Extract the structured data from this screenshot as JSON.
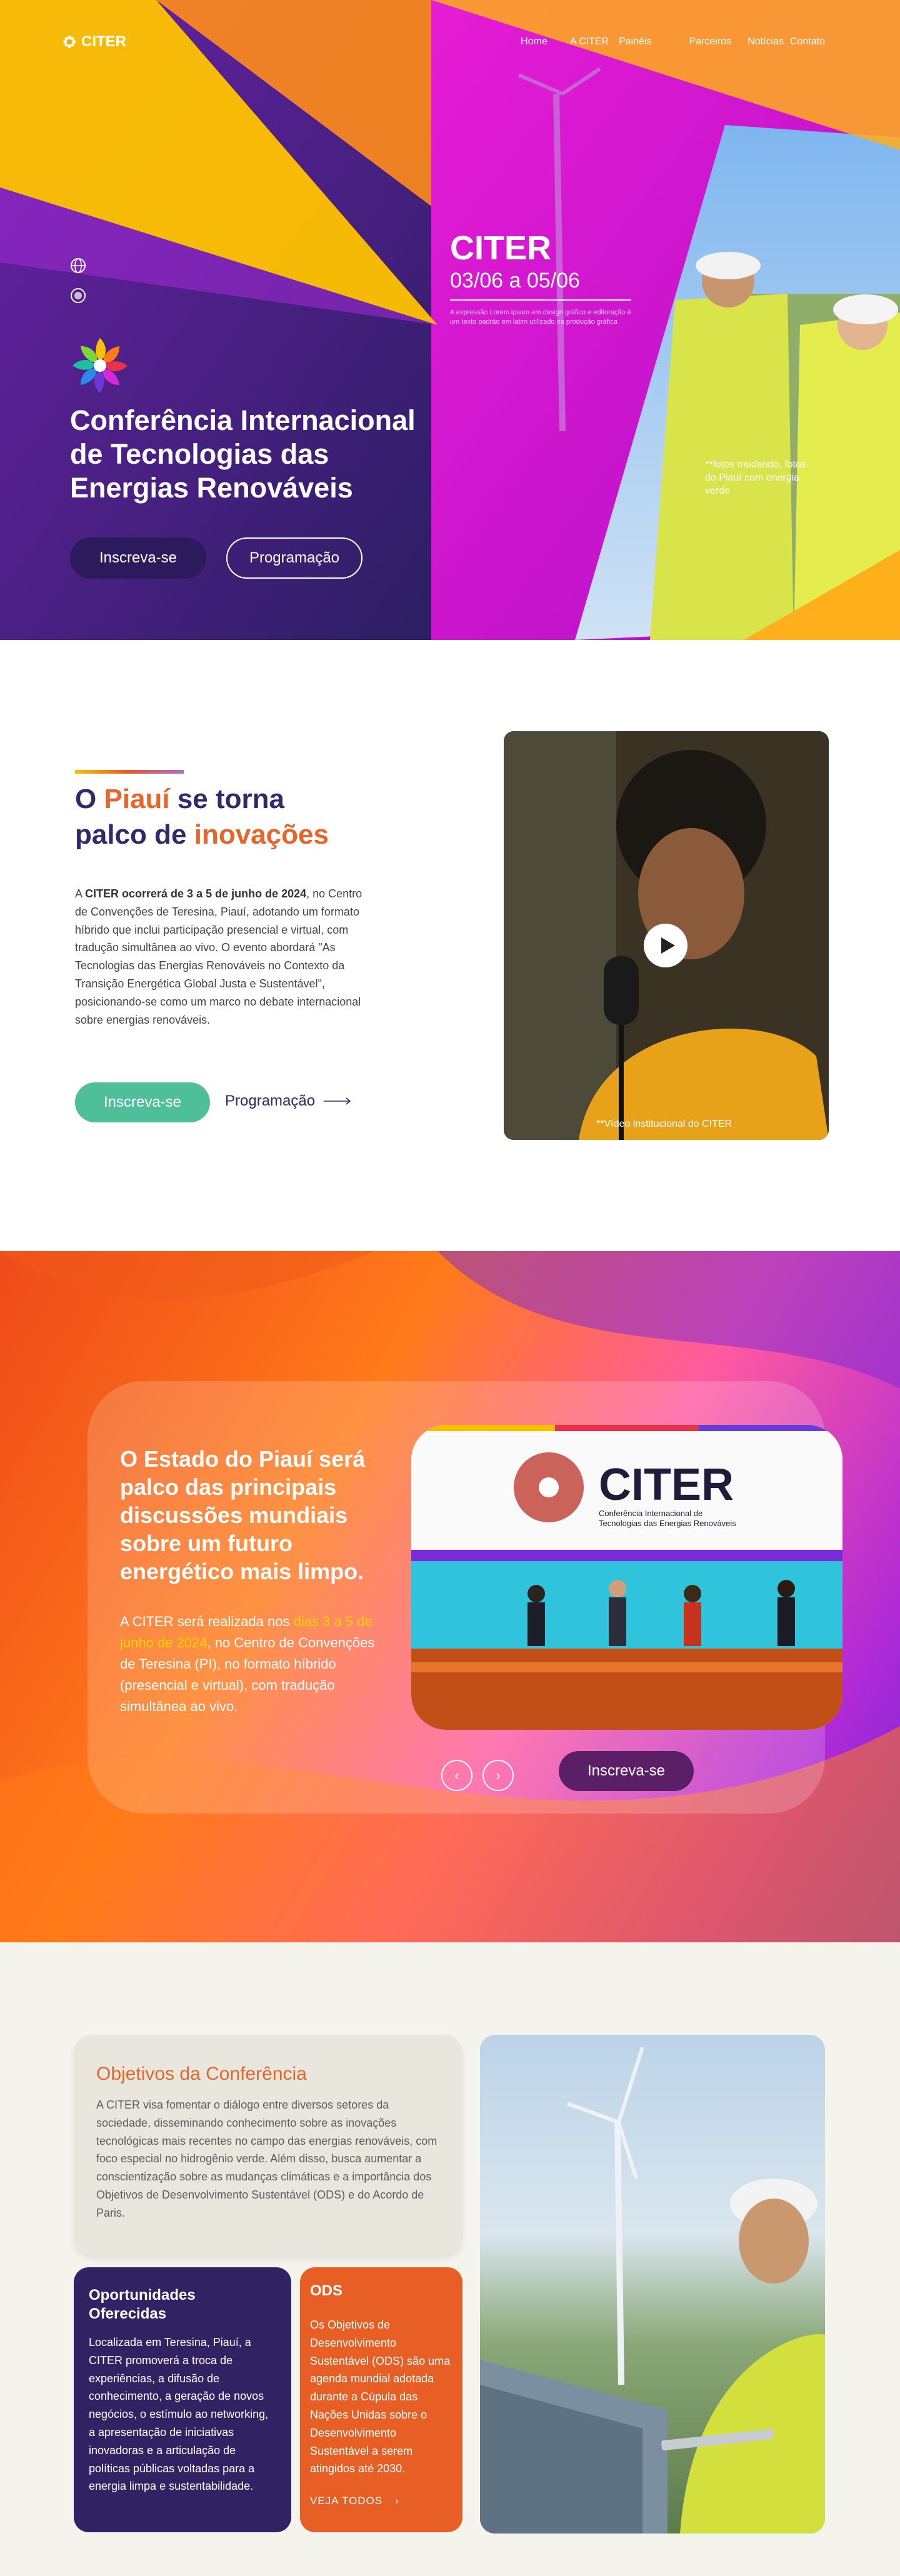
{
  "brand": {
    "name": "CITER"
  },
  "nav": {
    "links": [
      "Home",
      "A CITER",
      "Painéis",
      "Parceiros",
      "Notícias",
      "Contato"
    ]
  },
  "hero": {
    "title": "Conferência Internacional de Tecnologias das Energias Renováveis",
    "brand_title": "CITER",
    "dates": "03/06 a 05/06",
    "lorem": "A expressão Lorem ipsum em design gráfico e editoração é um texto padrão em latim utilizado na produção gráfica",
    "photo_note": "**fotos mudando, fotos do Piauí com energia verde",
    "cta_primary": "Inscreva-se",
    "cta_secondary": "Programação"
  },
  "about": {
    "heading_parts": [
      "O ",
      "Piauí",
      " se torna",
      "palco de ",
      "inovações"
    ],
    "body_bold": "CITER ocorrerá de 3 a 5 de junho de 2024",
    "body_prefix": "A ",
    "body_rest": ", no Centro de Convenções de Teresina, Piauí, adotando um formato híbrido que inclui participação presencial e virtual, com tradução simultânea ao vivo. O evento abordará \"As Tecnologias das Energias Renováveis no Contexto da Transição Energética Global Justa e Sustentável\", posicionando-se como um marco no debate internacional sobre energias renováveis.",
    "cta_primary": "Inscreva-se",
    "cta_link": "Programação",
    "video_caption": "**Vídeo institucional do CITER"
  },
  "state": {
    "title_plain_1": "O Estado do Piauí será palco das principais ",
    "title_bold": "discussões mundiais sobre um futuro energético",
    "title_plain_2": " mais limpo.",
    "text_prefix": "A CITER será realizada nos ",
    "text_highlight": "dias 3 a 5 de junho de 2024",
    "text_rest": ", no Centro de Convenções de Teresina (PI), no formato híbrido (presencial e virtual), com tradução simultânea ao vivo.",
    "banner_brand": "CITER",
    "banner_subtitle": "Conferência Internacional de Tecnologias das Energias Renováveis",
    "cta": "Inscreva-se",
    "arrow_left": "‹",
    "arrow_right": "›"
  },
  "goals": {
    "title": "Objetivos da Conferência",
    "body": "A CITER visa fomentar o diálogo entre diversos setores da sociedade, disseminando conhecimento sobre as inovações tecnológicas mais recentes no campo das energias renováveis, com foco especial no hidrogênio verde. Além disso, busca aumentar a conscientização sobre as mudanças climáticas e a importância dos Objetivos de Desenvolvimento Sustentável (ODS) e do Acordo de Paris.",
    "opp_title": "Oportunidades Oferecidas",
    "opp_body": "Localizada em Teresina, Piauí, a CITER promoverá a troca de experiências, a difusão de conhecimento, a geração de novos negócios, o estímulo ao networking, a apresentação de iniciativas inovadoras e a articulação de políticas públicas voltadas para a energia limpa e sustentabilidade.",
    "ods_title": "ODS",
    "ods_body": "Os Objetivos de Desenvolvimento Sustentável (ODS) são uma agenda mundial adotada durante a Cúpula das Nações Unidas sobre o Desenvolvimento Sustentável a serem atingidos até 2030.",
    "ods_more": "VEJA TODOS",
    "ods_more_arrow": "›"
  },
  "colors": {
    "accent_orange": "#e8652a",
    "navy": "#2e2a6b",
    "green": "#4fbf9a",
    "plum": "#5a1f66"
  }
}
